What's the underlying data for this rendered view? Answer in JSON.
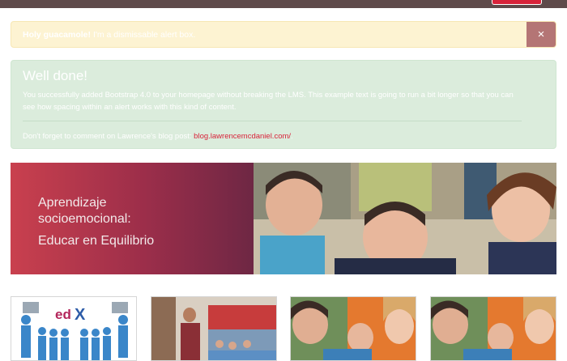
{
  "alert_warning": {
    "strong": "Holy guacamole!",
    "text": " I'm a dismissable alert box.",
    "close_label": "×"
  },
  "alert_success": {
    "heading": "Well done!",
    "body": "You successfully added Bootstrap 4.0 to your homepage without breaking the LMS. This example text is going to run a bit longer so that you can see how spacing within an alert works with this kind of content.",
    "note_prefix": "Don't forget to comment on Lawrence's blog post: ",
    "link_text": "blog.lawrencemcdaniel.com/",
    "note_suffix": "."
  },
  "banner": {
    "title_line1": "Aprendizaje",
    "title_line2": "socioemocional:",
    "subtitle": "Educar en Equilibrio"
  },
  "cards": [
    {
      "logo_e": "ed",
      "logo_x": "X"
    },
    {},
    {},
    {}
  ],
  "colors": {
    "accent": "#d8233a",
    "warning_bg": "#fdf3d2",
    "success_bg": "#dbecdc",
    "close_bg": "#b47575"
  }
}
